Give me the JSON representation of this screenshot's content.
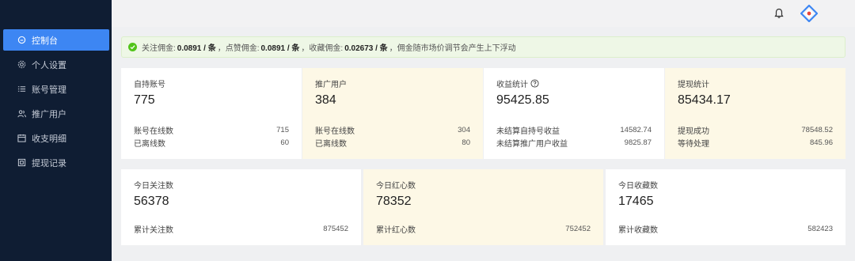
{
  "sidebar": {
    "items": [
      {
        "label": "控制台",
        "icon": "dashboard-icon",
        "active": true
      },
      {
        "label": "个人设置",
        "icon": "settings-icon",
        "active": false
      },
      {
        "label": "账号管理",
        "icon": "list-icon",
        "active": false
      },
      {
        "label": "推广用户",
        "icon": "users-icon",
        "active": false
      },
      {
        "label": "收支明细",
        "icon": "calendar-icon",
        "active": false
      },
      {
        "label": "提现记录",
        "icon": "record-icon",
        "active": false
      }
    ]
  },
  "header": {
    "bell_icon": "bell-icon",
    "logo_icon": "diamond-logo-icon"
  },
  "notice": {
    "follow_label": "关注佣金:",
    "follow_value": "0.0891 / 条",
    "like_label": "点赞佣金:",
    "like_value": "0.0891 / 条",
    "collect_label": "收藏佣金:",
    "collect_value": "0.02673 / 条",
    "note": "佣金随市场价调节会产生上下浮动",
    "sep": "，"
  },
  "cards_row1": [
    {
      "title": "自持账号",
      "value": "775",
      "rows": [
        {
          "label": "账号在线数",
          "num": "715"
        },
        {
          "label": "已离线数",
          "num": "60"
        }
      ]
    },
    {
      "title": "推广用户",
      "value": "384",
      "rows": [
        {
          "label": "账号在线数",
          "num": "304"
        },
        {
          "label": "已离线数",
          "num": "80"
        }
      ]
    },
    {
      "title": "收益统计",
      "value": "95425.85",
      "rows": [
        {
          "label": "未结算自持号收益",
          "num": "14582.74"
        },
        {
          "label": "未结算推广用户收益",
          "num": "9825.87"
        }
      ]
    },
    {
      "title": "提现统计",
      "value": "85434.17",
      "rows": [
        {
          "label": "提现成功",
          "num": "78548.52"
        },
        {
          "label": "等待处理",
          "num": "845.96"
        }
      ]
    }
  ],
  "cards_row2": [
    {
      "title": "今日关注数",
      "value": "56378",
      "rows": [
        {
          "label": "累计关注数",
          "num": "875452"
        }
      ]
    },
    {
      "title": "今日红心数",
      "value": "78352",
      "rows": [
        {
          "label": "累计红心数",
          "num": "752452"
        }
      ]
    },
    {
      "title": "今日收藏数",
      "value": "17465",
      "rows": [
        {
          "label": "累计收藏数",
          "num": "582423"
        }
      ]
    }
  ],
  "colors": {
    "sidebar_bg": "#0f1d33",
    "active_blue": "#3d86f3",
    "cream": "#fdf8e6",
    "notice_bg": "#eef7e6",
    "ok_green": "#52c41a"
  }
}
